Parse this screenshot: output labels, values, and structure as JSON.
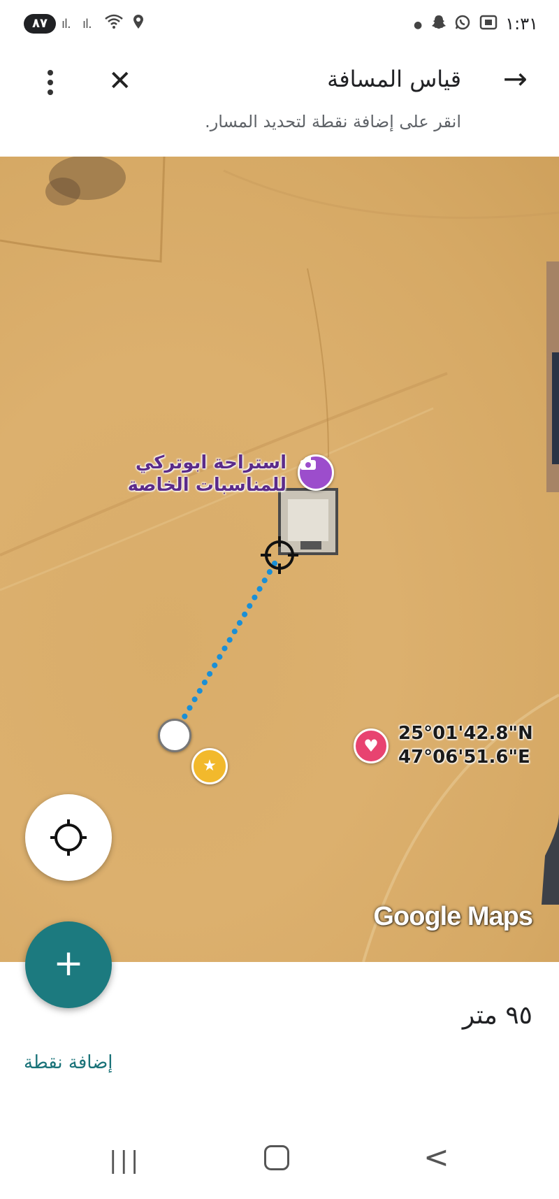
{
  "status_bar": {
    "battery": "٨٧",
    "signal_1": "ıl.",
    "signal_2": "ıl.",
    "time": "١:٣١"
  },
  "header": {
    "title": "قياس المسافة",
    "subtitle": "انقر على إضافة نقطة لتحديد المسار."
  },
  "map": {
    "poi_label": "استراحة ابوتركي للمناسبات الخاصة",
    "coordinates_lat": "25°01'42.8\"N",
    "coordinates_lng": "47°06'51.6\"E",
    "watermark": "Google Maps"
  },
  "bottom_sheet": {
    "fab_label": "+",
    "distance": "٩٥ متر",
    "add_point": "إضافة نقطة"
  },
  "nav_bar": {
    "recent": "|||",
    "back": "<"
  },
  "colors": {
    "accent_teal": "#1c7a7f",
    "poi_purple": "#9c4dcc",
    "heart_pink": "#e84370",
    "star_yellow": "#f2b92c",
    "route_blue": "#1a8fd6"
  },
  "icons": [
    "more-vert-icon",
    "close-icon",
    "arrow-forward-icon",
    "camera-icon",
    "heart-icon",
    "star-icon",
    "crosshair-icon",
    "my-location-icon",
    "plus-icon"
  ]
}
